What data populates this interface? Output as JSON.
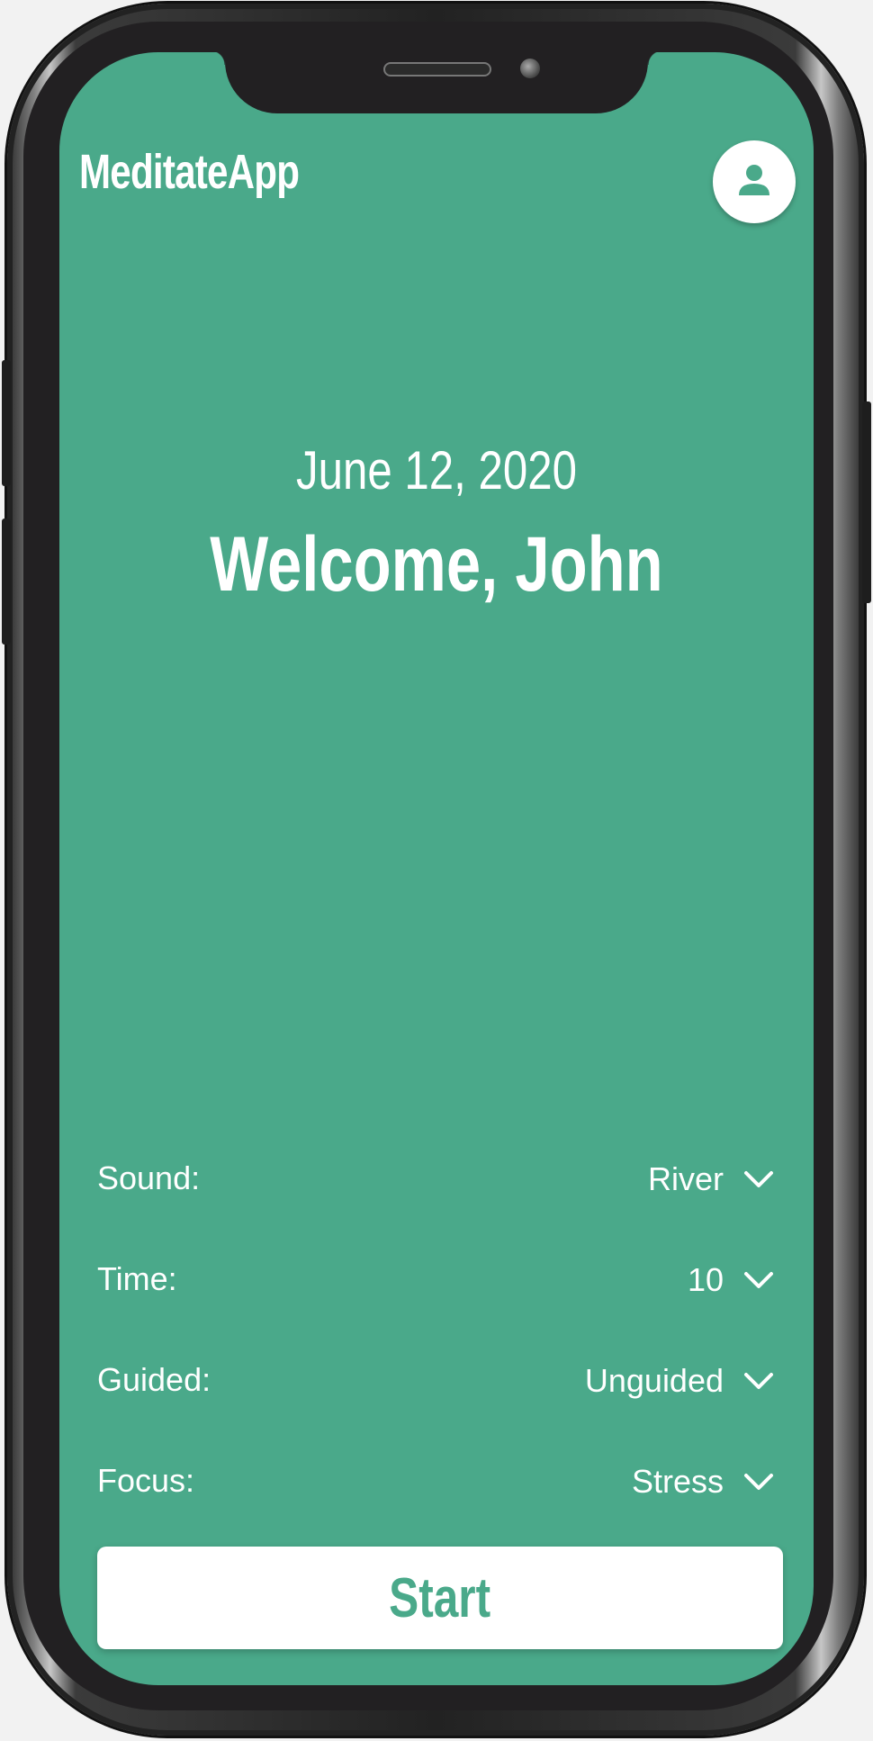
{
  "app": {
    "title": "MeditateApp",
    "accent_color": "#4aa98a"
  },
  "header": {
    "avatar_icon": "user-icon"
  },
  "hero": {
    "date": "June 12, 2020",
    "welcome": "Welcome, John"
  },
  "settings": [
    {
      "label": "Sound:",
      "value": "River"
    },
    {
      "label": "Time:",
      "value": "10"
    },
    {
      "label": "Guided:",
      "value": "Unguided"
    },
    {
      "label": "Focus:",
      "value": "Stress"
    }
  ],
  "actions": {
    "start_label": "Start"
  }
}
